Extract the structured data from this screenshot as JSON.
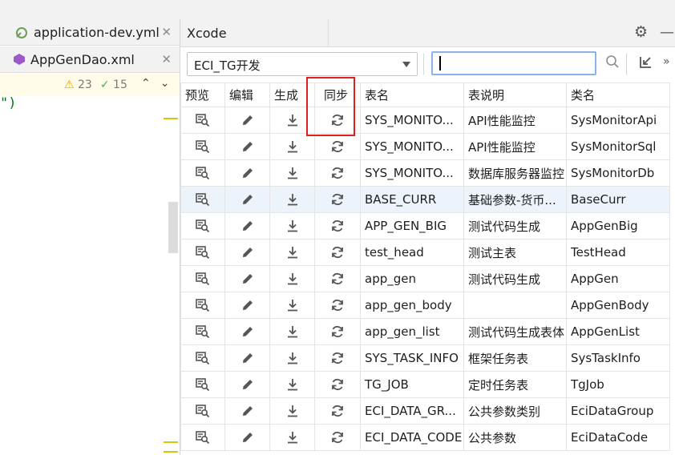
{
  "editor": {
    "tabs": [
      {
        "label": "application-dev.yml",
        "close": "✕"
      },
      {
        "label": "AppGenDao.xml",
        "close": "✕"
      }
    ],
    "code_fragment": "\")",
    "warnings": "23",
    "checks": "15"
  },
  "panel": {
    "title": "Xcode",
    "datasource_selected": "ECI_TG开发",
    "search_value": "",
    "columns": {
      "preview": "预览",
      "edit": "编辑",
      "generate": "生成",
      "sync": "同步",
      "table_name": "表名",
      "table_desc": "表说明",
      "class_name": "类名"
    },
    "rows": [
      {
        "table_name": "SYS_MONITO...",
        "table_desc": "API性能监控",
        "class_name": "SysMonitorApi"
      },
      {
        "table_name": "SYS_MONITO...",
        "table_desc": "API性能监控",
        "class_name": "SysMonitorSql"
      },
      {
        "table_name": "SYS_MONITO...",
        "table_desc": "数据库服务器监控",
        "class_name": "SysMonitorDb"
      },
      {
        "table_name": "BASE_CURR",
        "table_desc": "基础参数-货币...",
        "class_name": "BaseCurr"
      },
      {
        "table_name": "APP_GEN_BIG",
        "table_desc": "测试代码生成",
        "class_name": "AppGenBig"
      },
      {
        "table_name": "test_head",
        "table_desc": "测试主表",
        "class_name": "TestHead"
      },
      {
        "table_name": "app_gen",
        "table_desc": "测试代码生成",
        "class_name": "AppGen"
      },
      {
        "table_name": "app_gen_body",
        "table_desc": "",
        "class_name": "AppGenBody"
      },
      {
        "table_name": "app_gen_list",
        "table_desc": "测试代码生成表体",
        "class_name": "AppGenList"
      },
      {
        "table_name": "SYS_TASK_INFO",
        "table_desc": "框架任务表",
        "class_name": "SysTaskInfo"
      },
      {
        "table_name": "TG_JOB",
        "table_desc": "定时任务表",
        "class_name": "TgJob"
      },
      {
        "table_name": "ECI_DATA_GR...",
        "table_desc": "公共参数类别",
        "class_name": "EciDataGroup"
      },
      {
        "table_name": "ECI_DATA_CODE",
        "table_desc": "公共参数",
        "class_name": "EciDataCode"
      }
    ],
    "selected_row_index": 3
  },
  "colors": {
    "accent_border": "#8ab4ea",
    "highlight_box": "#e02020",
    "selected_row": "#edf3fb"
  }
}
